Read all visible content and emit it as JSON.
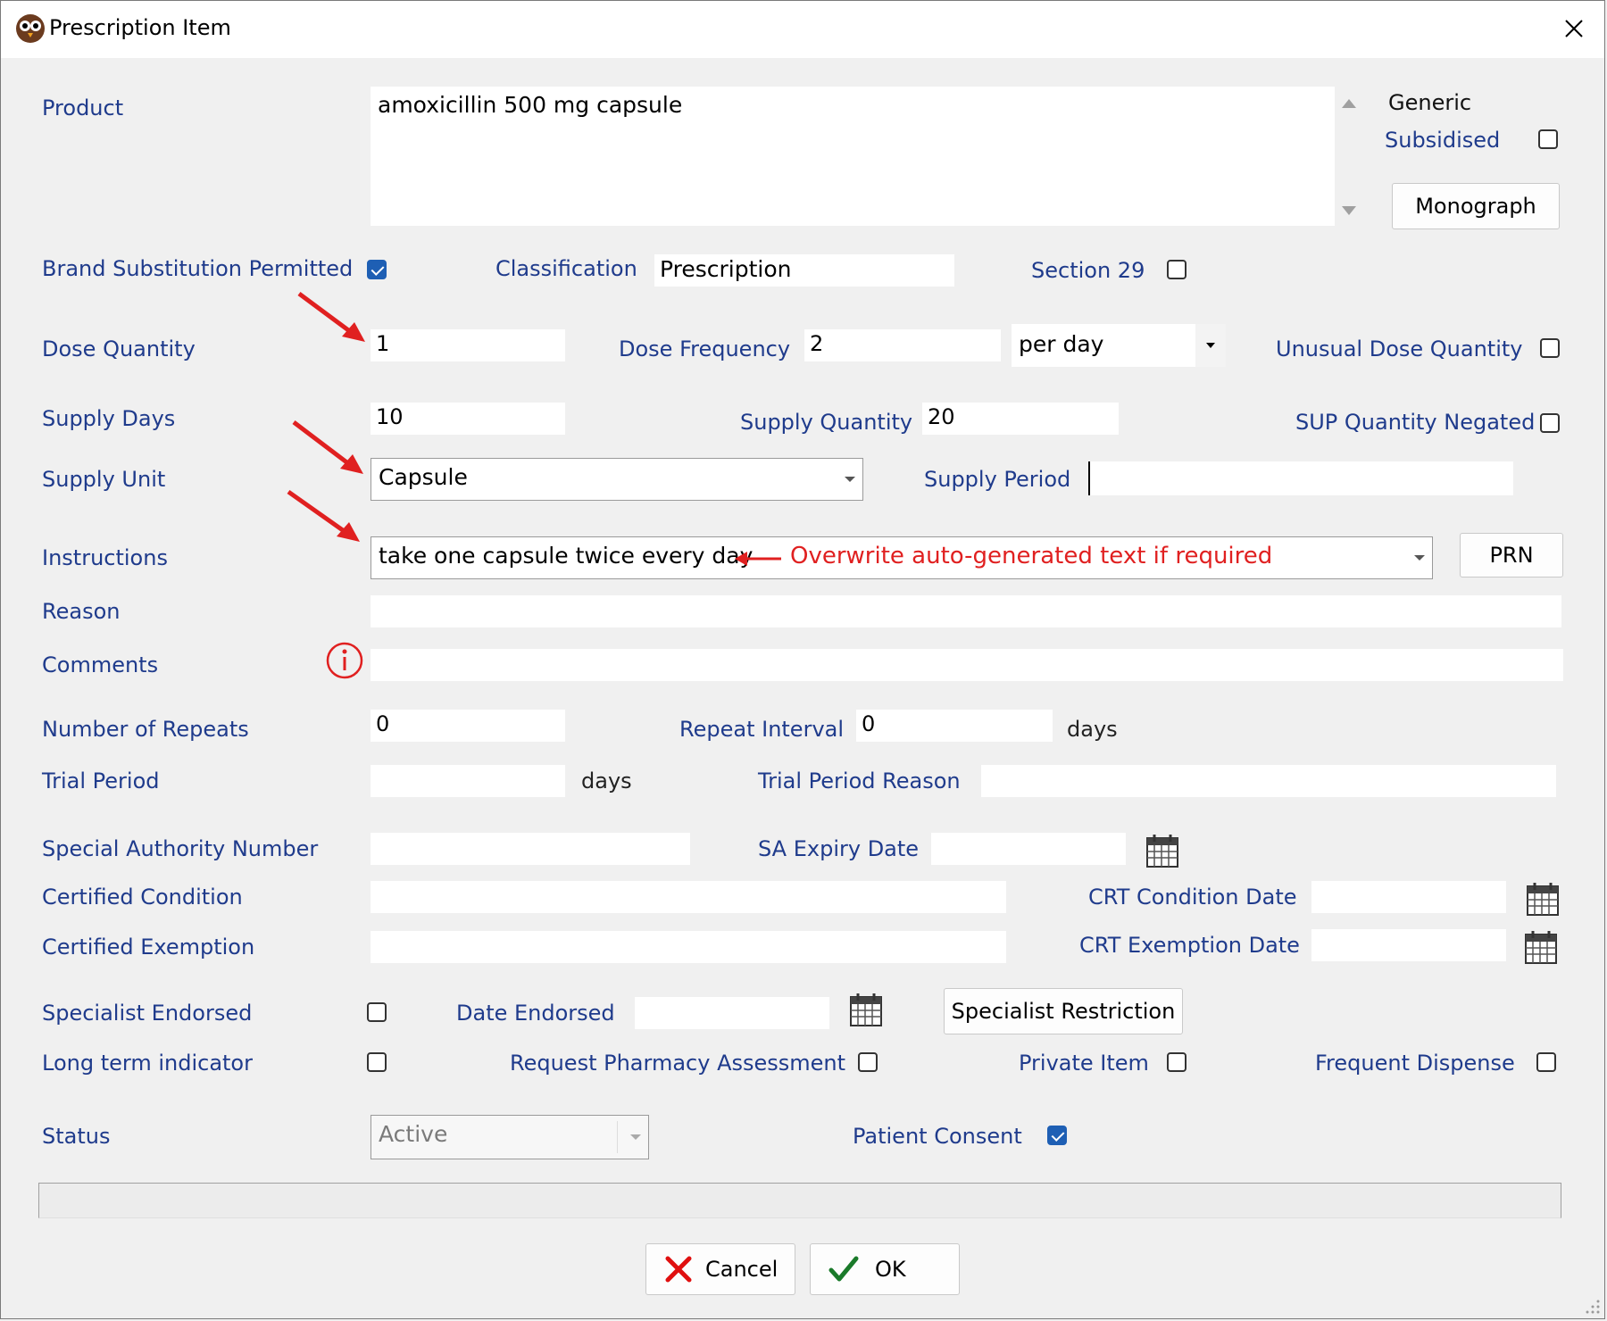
{
  "window": {
    "title": "Prescription Item"
  },
  "product": {
    "label": "Product",
    "value": "amoxicillin 500 mg capsule"
  },
  "generic_label": "Generic",
  "subsidised": {
    "label": "Subsidised",
    "checked": false
  },
  "monograph_button": "Monograph",
  "brand_substitution": {
    "label": "Brand Substitution Permitted",
    "checked": true
  },
  "classification": {
    "label": "Classification",
    "value": "Prescription"
  },
  "section29": {
    "label": "Section 29",
    "checked": false
  },
  "dose_quantity": {
    "label": "Dose Quantity",
    "value": "1"
  },
  "dose_frequency": {
    "label": "Dose Frequency",
    "value": "2",
    "period": "per day"
  },
  "unusual_dose": {
    "label": "Unusual Dose Quantity",
    "checked": false
  },
  "supply_days": {
    "label": "Supply Days",
    "value": "10"
  },
  "supply_quantity": {
    "label": "Supply Quantity",
    "value": "20"
  },
  "sup_negated": {
    "label": "SUP Quantity Negated",
    "checked": false
  },
  "supply_unit": {
    "label": "Supply Unit",
    "value": "Capsule"
  },
  "supply_period": {
    "label": "Supply Period",
    "value": ""
  },
  "instructions": {
    "label": "Instructions",
    "value": "take one capsule twice every day"
  },
  "prn_button": "PRN",
  "annotation": "Overwrite auto-generated text if required",
  "reason": {
    "label": "Reason",
    "value": ""
  },
  "comments": {
    "label": "Comments",
    "value": ""
  },
  "repeats": {
    "label": "Number of Repeats",
    "value": "0"
  },
  "repeat_interval": {
    "label": "Repeat Interval",
    "value": "0",
    "unit": "days"
  },
  "trial_period": {
    "label": "Trial Period",
    "value": "",
    "unit": "days"
  },
  "trial_reason": {
    "label": "Trial Period Reason",
    "value": ""
  },
  "sa_number": {
    "label": "Special Authority Number",
    "value": ""
  },
  "sa_expiry": {
    "label": "SA Expiry Date",
    "value": ""
  },
  "certified_condition": {
    "label": "Certified Condition",
    "value": ""
  },
  "crt_condition_date": {
    "label": "CRT Condition Date",
    "value": ""
  },
  "certified_exemption": {
    "label": "Certified Exemption",
    "value": ""
  },
  "crt_exemption_date": {
    "label": "CRT Exemption Date",
    "value": ""
  },
  "specialist_endorsed": {
    "label": "Specialist Endorsed",
    "checked": false
  },
  "date_endorsed": {
    "label": "Date Endorsed",
    "value": ""
  },
  "specialist_restriction_button": "Specialist Restriction",
  "long_term": {
    "label": "Long term indicator",
    "checked": false
  },
  "pharmacy_assessment": {
    "label": "Request Pharmacy Assessment",
    "checked": false
  },
  "private_item": {
    "label": "Private Item",
    "checked": false
  },
  "frequent_dispense": {
    "label": "Frequent Dispense",
    "checked": false
  },
  "status": {
    "label": "Status",
    "value": "Active"
  },
  "patient_consent": {
    "label": "Patient Consent",
    "checked": true
  },
  "buttons": {
    "cancel": "Cancel",
    "ok": "OK"
  },
  "colors": {
    "label": "#1f3b8c",
    "annotation": "#e02020",
    "checkbox_on": "#1e5fb4"
  }
}
